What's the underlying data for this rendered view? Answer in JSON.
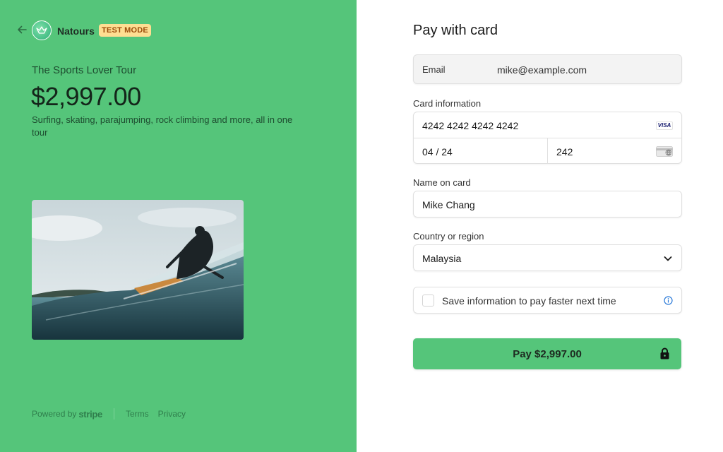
{
  "merchant": {
    "name": "Natours",
    "badge": "TEST MODE"
  },
  "product": {
    "name": "The Sports Lover Tour",
    "price": "$2,997.00",
    "description": "Surfing, skating, parajumping, rock climbing and more, all in one tour"
  },
  "footer": {
    "powered_by": "Powered by",
    "brand": "stripe",
    "terms": "Terms",
    "privacy": "Privacy"
  },
  "form": {
    "title": "Pay with card",
    "email": {
      "label": "Email",
      "value": "mike@example.com"
    },
    "card": {
      "label": "Card information",
      "number": "4242 4242 4242 4242",
      "brand": "VISA",
      "expiry": "04 / 24",
      "cvc": "242"
    },
    "name": {
      "label": "Name on card",
      "value": "Mike Chang"
    },
    "country": {
      "label": "Country or region",
      "value": "Malaysia"
    },
    "save_info": {
      "label": "Save information to pay faster next time",
      "checked": false
    },
    "pay_button": "Pay $2,997.00"
  },
  "colors": {
    "accent": "#55c57a",
    "badge_bg": "#ffde92",
    "badge_text": "#9c4b09"
  },
  "icons": [
    "arrow-left-icon",
    "natours-logo-icon",
    "visa-icon",
    "cvc-card-icon",
    "chevron-down-icon",
    "info-icon",
    "lock-icon"
  ]
}
